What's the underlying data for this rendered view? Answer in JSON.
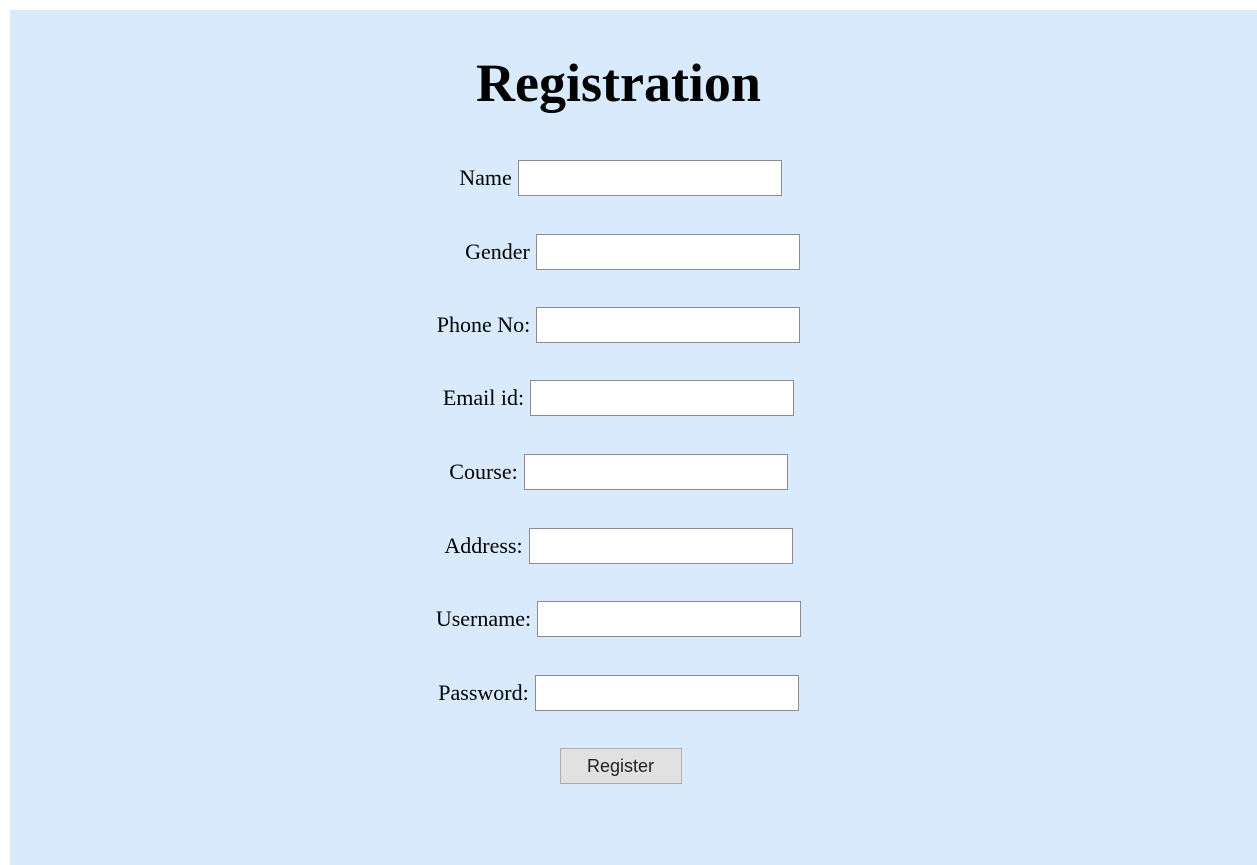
{
  "page": {
    "title": "Registration",
    "background_color": "#d8eafc"
  },
  "fields": [
    {
      "label": "Name",
      "value": ""
    },
    {
      "label": "Gender",
      "value": ""
    },
    {
      "label": "Phone No:",
      "value": ""
    },
    {
      "label": "Email id:",
      "value": ""
    },
    {
      "label": "Course:",
      "value": ""
    },
    {
      "label": "Address:",
      "value": ""
    },
    {
      "label": "Username:",
      "value": ""
    },
    {
      "label": "Password:",
      "value": ""
    }
  ],
  "actions": {
    "register_label": "Register"
  }
}
